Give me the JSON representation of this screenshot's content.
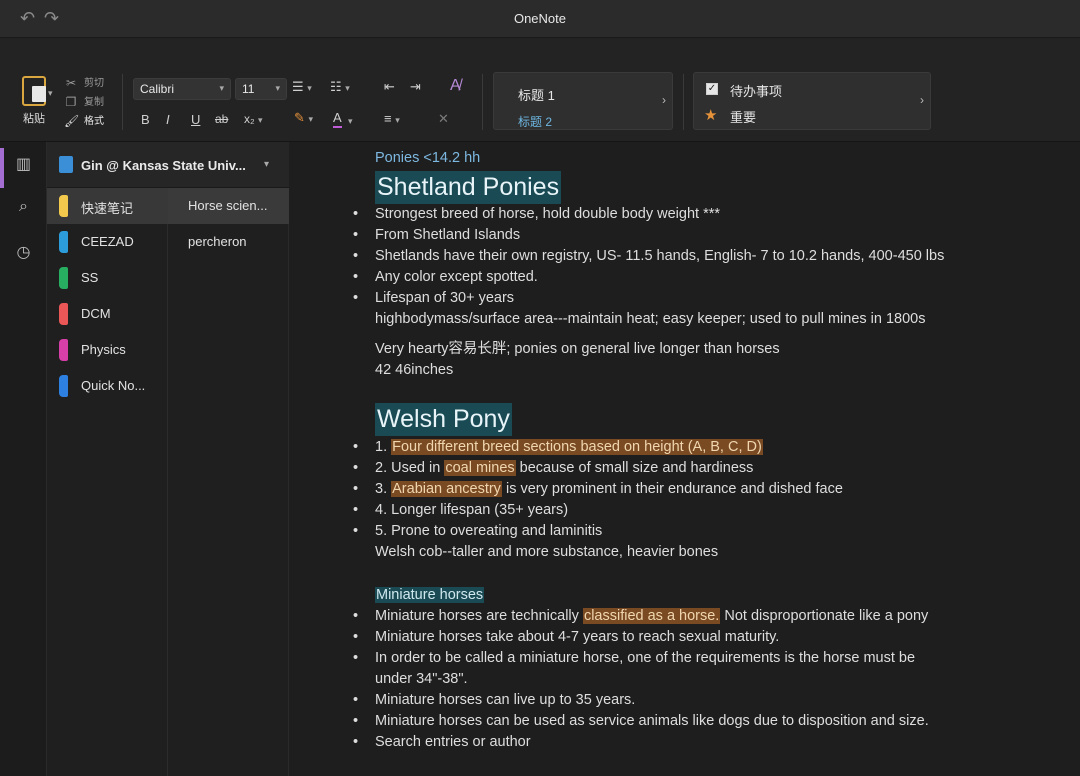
{
  "app": {
    "title": "OneNote",
    "undo": "↶",
    "redo": "↷"
  },
  "ribbon": {
    "paste_label": "粘贴",
    "cut_label": "剪切",
    "copy_label": "复制",
    "format_label": "格式",
    "font_name": "Calibri",
    "font_size": "11",
    "styles": {
      "heading1": "标题 1",
      "heading2": "标题 2"
    },
    "tags": {
      "todo": "待办事项",
      "important": "重要"
    }
  },
  "notebook": {
    "name": "Gin @ Kansas State Univ...",
    "sections": [
      {
        "name": "快速笔记",
        "color": "#f2c94c"
      },
      {
        "name": "CEEZAD",
        "color": "#2d9cdb"
      },
      {
        "name": "SS",
        "color": "#27ae60"
      },
      {
        "name": "DCM",
        "color": "#eb5757"
      },
      {
        "name": "Physics",
        "color": "#d63ea8"
      },
      {
        "name": "Quick No...",
        "color": "#2d7fe0"
      }
    ],
    "pages": [
      {
        "name": "Horse scien..."
      },
      {
        "name": "percheron"
      }
    ]
  },
  "content": {
    "caption": "Ponies <14.2 hh",
    "shetland": {
      "title": "Shetland Ponies",
      "bullets": [
        "Strongest breed of horse, hold double body weight ***",
        "From Shetland Islands",
        "Shetlands have their own registry, US- 11.5 hands, English- 7 to 10.2 hands, 400-450 lbs",
        "Any color except spotted.",
        "Lifespan of 30+ years"
      ],
      "lines": [
        "highbodymass/surface area---maintain heat; easy keeper; used to pull mines in 1800s",
        "Very hearty容易长胖; ponies on general live longer than horses",
        "42 46inches"
      ]
    },
    "welsh": {
      "title": "Welsh Pony",
      "b1_pre": "1. ",
      "b1_hl": "Four different breed sections based on height (A, B, C, D)",
      "b2_pre": "2. Used in ",
      "b2_hl": "coal mines",
      "b2_post": " because of small size and hardiness",
      "b3_pre": "3. ",
      "b3_hl": "Arabian ancestry",
      "b3_post": " is very prominent in their endurance and dished face",
      "b4": "4. Longer lifespan (35+ years)",
      "b5": "5. Prone to overeating and laminitis",
      "line": "Welsh cob--taller and more substance, heavier bones"
    },
    "mini": {
      "title": "Miniature horses",
      "b1_pre": "Miniature horses are technically ",
      "b1_hl": "classified as a horse.",
      "b1_post": "  Not disproportionate like a pony",
      "b2": "Miniature horses take about 4-7 years to reach sexual maturity.",
      "b3a": "In order to be called a miniature horse, one of the requirements is the horse must be",
      "b3b": "under 34\"-38\".",
      "b4": "Miniature horses can live up to 35 years.",
      "b5": "Miniature horses can be used as service animals like dogs due to disposition and size.",
      "b6": "Search entries or author"
    }
  }
}
